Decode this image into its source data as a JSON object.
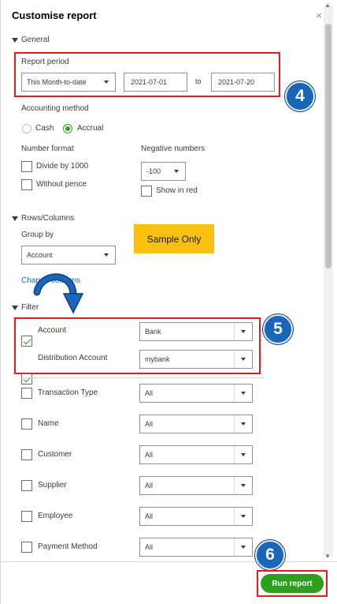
{
  "dialog": {
    "title": "Customise report",
    "close_icon": "×"
  },
  "general": {
    "section_label": "General",
    "report_period_label": "Report period",
    "period_select": "This Month-to-date",
    "from_date": "2021-07-01",
    "to_label": "to",
    "to_date": "2021-07-20",
    "accounting_method_label": "Accounting method",
    "cash_label": "Cash",
    "accrual_label": "Accrual",
    "number_format_label": "Number format",
    "divide_by_1000_label": "Divide by 1000",
    "without_pence_label": "Without pence",
    "negative_numbers_label": "Negative numbers",
    "negative_select": "-100",
    "show_in_red_label": "Show in red"
  },
  "rows_columns": {
    "section_label": "Rows/Columns",
    "group_by_label": "Group by",
    "group_by_select": "Account",
    "change_columns_link": "Change columns"
  },
  "annotations": {
    "sample_only": "Sample Only",
    "step4": "4",
    "step5": "5",
    "step6": "6"
  },
  "filter": {
    "section_label": "Filter",
    "rows": [
      {
        "label": "Account",
        "value": "Bank",
        "checked": true
      },
      {
        "label": "Distribution Account",
        "value": "mybank",
        "checked": true
      },
      {
        "label": "Transaction Type",
        "value": "All",
        "checked": false
      },
      {
        "label": "Name",
        "value": "All",
        "checked": false
      },
      {
        "label": "Customer",
        "value": "All",
        "checked": false
      },
      {
        "label": "Supplier",
        "value": "All",
        "checked": false
      },
      {
        "label": "Employee",
        "value": "All",
        "checked": false
      },
      {
        "label": "Payment Method",
        "value": "All",
        "checked": false
      }
    ]
  },
  "footer": {
    "run_report_label": "Run report"
  },
  "colors": {
    "accent_green": "#2ca01c",
    "highlight_red": "#e41b1b",
    "badge_blue": "#1a66b8",
    "sample_yellow": "#f9c012",
    "link_blue": "#0077c5"
  }
}
